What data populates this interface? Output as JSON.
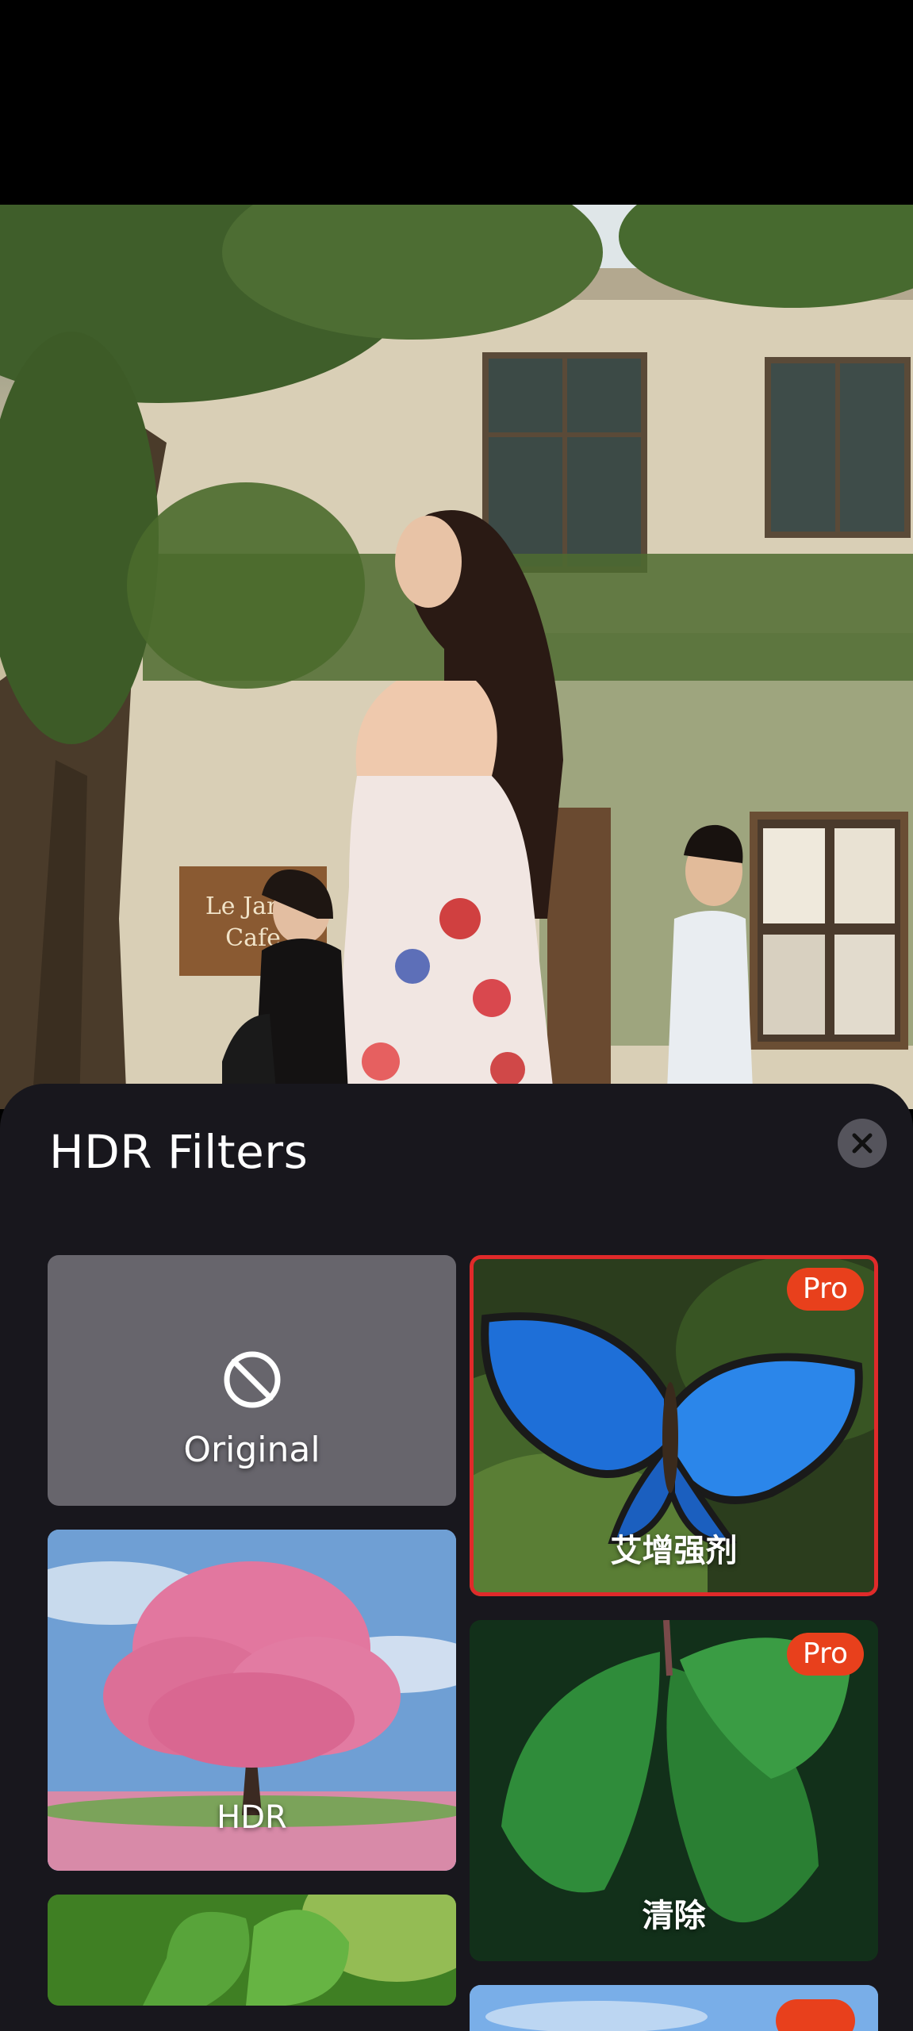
{
  "sheet": {
    "title": "HDR Filters",
    "close_icon": "close-icon"
  },
  "filters": [
    {
      "label": "Original",
      "icon": "no-filter-icon",
      "pro": false,
      "selected": false
    },
    {
      "label": "艾增强剂",
      "pro": true,
      "badge": "Pro",
      "selected": true
    },
    {
      "label": "HDR",
      "pro": false,
      "selected": false
    },
    {
      "label": "清除",
      "pro": true,
      "badge": "Pro",
      "selected": false
    },
    {
      "label": "",
      "pro": false,
      "selected": false
    },
    {
      "label": "",
      "pro": true,
      "selected": false
    }
  ],
  "colors": {
    "sheet_bg": "#18171d",
    "pro_badge": "#e8401c",
    "selected_border": "#e02a2a",
    "original_card": "#67656c"
  }
}
